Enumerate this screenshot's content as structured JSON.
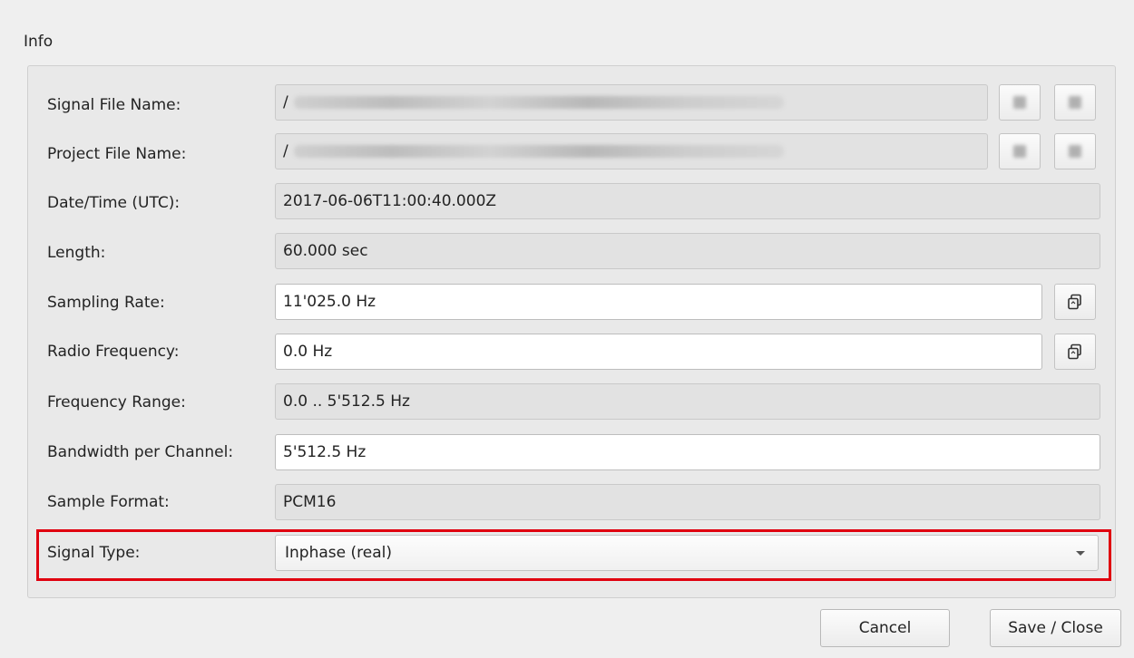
{
  "group": {
    "title": "Info"
  },
  "fields": {
    "signal_file": {
      "label": "Signal File Name:",
      "value": "/",
      "icons": [
        "blurred-icon",
        "blurred-icon"
      ]
    },
    "project_file": {
      "label": "Project File Name:",
      "value": "/",
      "icons": [
        "blurred-icon",
        "blurred-icon"
      ]
    },
    "datetime": {
      "label": "Date/Time (UTC):",
      "value": "2017-06-06T11:00:40.000Z"
    },
    "length": {
      "label": "Length:",
      "value": "60.000 sec"
    },
    "sampling_rate": {
      "label": "Sampling Rate:",
      "value": "11'025.0 Hz",
      "icon": "copy-icon"
    },
    "radio_frequency": {
      "label": "Radio Frequency:",
      "value": "0.0 Hz",
      "icon": "copy-icon"
    },
    "frequency_range": {
      "label": "Frequency Range:",
      "value": "0.0 .. 5'512.5 Hz"
    },
    "bandwidth": {
      "label": "Bandwidth per Channel:",
      "value": "5'512.5 Hz"
    },
    "sample_format": {
      "label": "Sample Format:",
      "value": "PCM16"
    },
    "signal_type": {
      "label": "Signal Type:",
      "value": "Inphase (real)"
    }
  },
  "highlight_color": "#e0000f",
  "buttons": {
    "cancel": "Cancel",
    "save_close": "Save / Close"
  }
}
